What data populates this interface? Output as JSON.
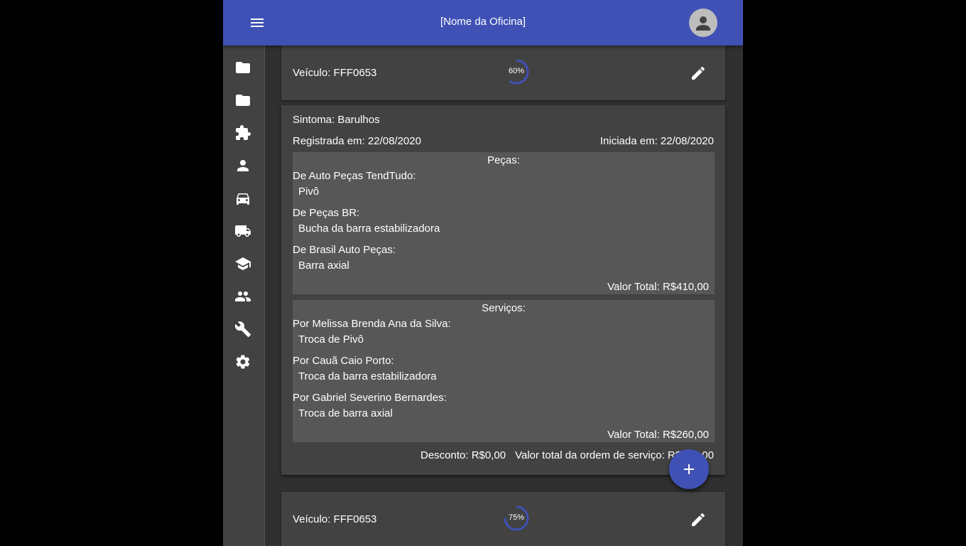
{
  "header": {
    "title": "[Nome da Oficina]",
    "menu_icon": "menu-icon",
    "avatar_icon": "account-icon"
  },
  "sidebar": {
    "items": [
      {
        "icon": "folder-icon"
      },
      {
        "icon": "folder-icon"
      },
      {
        "icon": "puzzle-icon"
      },
      {
        "icon": "person-icon"
      },
      {
        "icon": "car-icon"
      },
      {
        "icon": "truck-icon"
      },
      {
        "icon": "school-icon"
      },
      {
        "icon": "people-icon"
      },
      {
        "icon": "wrench-icon"
      },
      {
        "icon": "settings-icon"
      }
    ]
  },
  "orders": [
    {
      "vehicle": "Veículo: FFF0653",
      "progress": 60,
      "progress_label": "60%",
      "symptom": "Sintoma: Barulhos",
      "registered": "Registrada em: 22/08/2020",
      "started": "Iniciada em: 22/08/2020",
      "parts": {
        "title": "Peças:",
        "groups": [
          {
            "supplier": "De Auto Peças TendTudo:",
            "item": "Pivô"
          },
          {
            "supplier": "De Peças BR:",
            "item": "Bucha da barra estabilizadora"
          },
          {
            "supplier": "De Brasil Auto Peças:",
            "item": "Barra axial"
          }
        ],
        "total": "Valor Total: R$410,00"
      },
      "services": {
        "title": "Serviços:",
        "groups": [
          {
            "worker": "Por Melissa Brenda Ana da Silva:",
            "item": "Troca de Pivô"
          },
          {
            "worker": "Por Cauã Caio Porto:",
            "item": "Troca da barra estabilizadora"
          },
          {
            "worker": "Por Gabriel Severino Bernardes:",
            "item": "Troca de barra axial"
          }
        ],
        "total": "Valor Total: R$260,00"
      },
      "discount": "Desconto: R$0,00",
      "order_total": "Valor total da ordem de serviço: R$670,00"
    },
    {
      "vehicle": "Veículo: FFF0653",
      "progress": 75,
      "progress_label": "75%"
    }
  ],
  "colors": {
    "primary": "#3f51b5",
    "surface": "#424242",
    "background": "#303030",
    "box": "#575757"
  },
  "fab": {
    "icon": "plus-icon"
  }
}
